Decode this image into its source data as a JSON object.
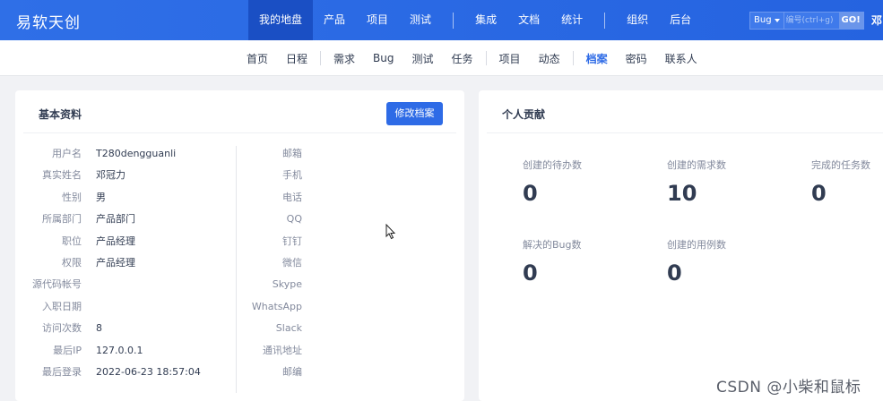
{
  "header": {
    "logo": "易软天创",
    "nav": [
      {
        "label": "我的地盘",
        "active": true
      },
      {
        "label": "产品"
      },
      {
        "label": "项目"
      },
      {
        "label": "测试"
      },
      {
        "sep": true
      },
      {
        "label": "集成"
      },
      {
        "label": "文档"
      },
      {
        "label": "统计"
      },
      {
        "sep": true
      },
      {
        "label": "组织"
      },
      {
        "label": "后台"
      }
    ],
    "search": {
      "type": "Bug",
      "placeholder": "编号(ctrl+g)",
      "go": "GO!"
    },
    "user": "邓"
  },
  "subnav": [
    {
      "label": "首页"
    },
    {
      "label": "日程"
    },
    {
      "sep": true
    },
    {
      "label": "需求"
    },
    {
      "label": "Bug"
    },
    {
      "label": "测试"
    },
    {
      "label": "任务"
    },
    {
      "sep": true
    },
    {
      "label": "项目"
    },
    {
      "label": "动态"
    },
    {
      "sep": true
    },
    {
      "label": "档案",
      "active": true
    },
    {
      "label": "密码"
    },
    {
      "label": "联系人"
    }
  ],
  "profile": {
    "title": "基本资料",
    "edit_button": "修改档案",
    "left_fields": [
      {
        "label": "用户名",
        "value": "T280dengguanli"
      },
      {
        "label": "真实姓名",
        "value": "邓冠力"
      },
      {
        "label": "性别",
        "value": "男"
      },
      {
        "label": "所属部门",
        "value": "产品部门"
      },
      {
        "label": "职位",
        "value": "产品经理"
      },
      {
        "label": "权限",
        "value": "产品经理"
      },
      {
        "label": "源代码帐号",
        "value": ""
      },
      {
        "label": "入职日期",
        "value": ""
      },
      {
        "label": "访问次数",
        "value": "8"
      },
      {
        "label": "最后IP",
        "value": "127.0.0.1"
      },
      {
        "label": "最后登录",
        "value": "2022-06-23 18:57:04"
      }
    ],
    "right_fields": [
      {
        "label": "邮箱"
      },
      {
        "label": "手机"
      },
      {
        "label": "电话"
      },
      {
        "label": "QQ"
      },
      {
        "label": "钉钉"
      },
      {
        "label": "微信"
      },
      {
        "label": "Skype"
      },
      {
        "label": "WhatsApp"
      },
      {
        "label": "Slack"
      },
      {
        "label": "通讯地址"
      },
      {
        "label": "邮编"
      }
    ]
  },
  "contribution": {
    "title": "个人贡献",
    "stats": [
      {
        "label": "创建的待办数",
        "value": "0"
      },
      {
        "label": "创建的需求数",
        "value": "10"
      },
      {
        "label": "完成的任务数",
        "value": "0"
      },
      {
        "label": "解决的Bug数",
        "value": "0"
      },
      {
        "label": "创建的用例数",
        "value": "0"
      }
    ]
  },
  "watermark": "CSDN @小柴和鼠标",
  "colors": {
    "accent": "#2e6be6",
    "header_active": "#1a4fc4",
    "text": "#313c52",
    "label": "#838a9d"
  }
}
